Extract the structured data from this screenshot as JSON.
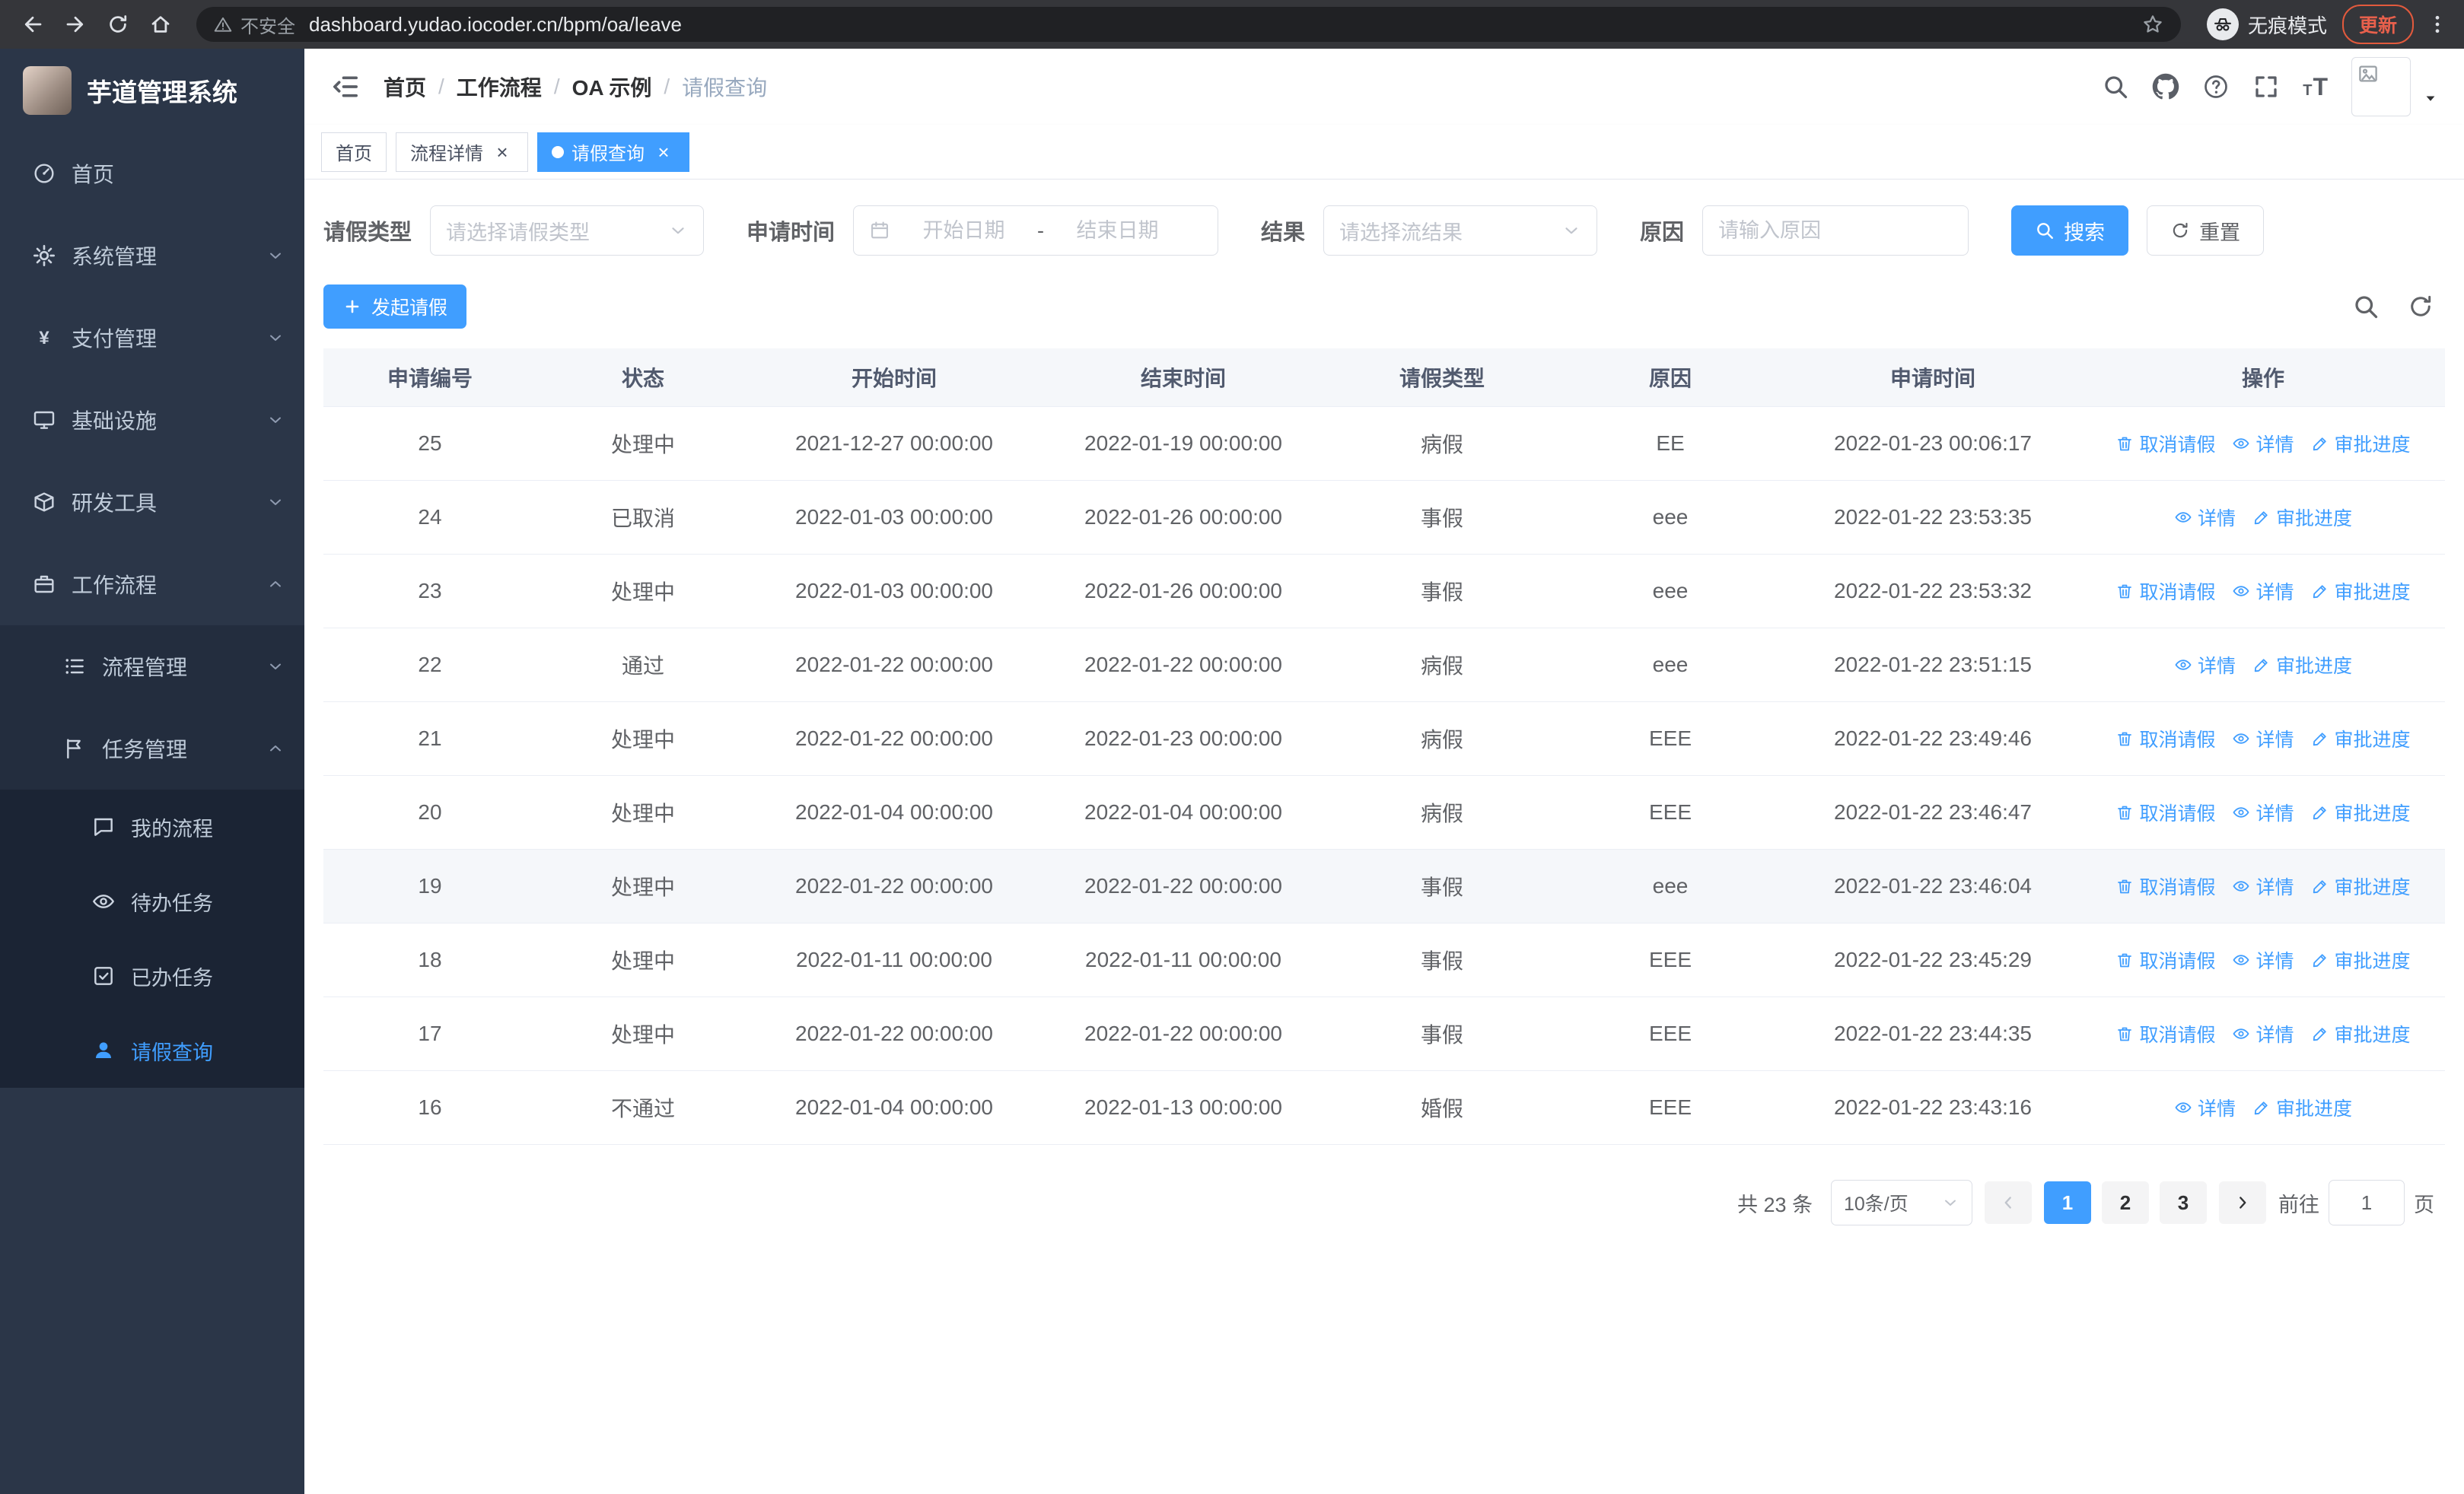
{
  "colors": {
    "accent": "#409eff",
    "sidebar_bg": "#2b3648",
    "sidebar_submenu_bg": "#232d3e",
    "sidebar_subsubmenu_bg": "#1b2434",
    "chrome_bg": "#35363a",
    "update_accent": "#e25a3d",
    "table_header_bg": "#f5f7fa"
  },
  "browser": {
    "security_label": "不安全",
    "url": "dashboard.yudao.iocoder.cn/bpm/oa/leave",
    "incognito_label": "无痕模式",
    "update_label": "更新"
  },
  "sidebar": {
    "logo_title": "芋道管理系统",
    "items": [
      {
        "name": "home",
        "label": "首页",
        "icon": "dashboard",
        "depth": 1
      },
      {
        "name": "system-management",
        "label": "系统管理",
        "icon": "gear",
        "depth": 1,
        "arrow": "down"
      },
      {
        "name": "payment-management",
        "label": "支付管理",
        "icon": "yen",
        "depth": 1,
        "arrow": "down"
      },
      {
        "name": "infrastructure",
        "label": "基础设施",
        "icon": "monitor",
        "depth": 1,
        "arrow": "down"
      },
      {
        "name": "dev-tools",
        "label": "研发工具",
        "icon": "box",
        "depth": 1,
        "arrow": "down"
      },
      {
        "name": "workflow",
        "label": "工作流程",
        "icon": "briefcase",
        "depth": 1,
        "arrow": "up"
      },
      {
        "name": "process-management",
        "label": "流程管理",
        "icon": "list",
        "depth": 2,
        "arrow": "down"
      },
      {
        "name": "task-management",
        "label": "任务管理",
        "icon": "flag",
        "depth": 2,
        "arrow": "up"
      },
      {
        "name": "my-process",
        "label": "我的流程",
        "icon": "chat",
        "depth": 3
      },
      {
        "name": "todo-task",
        "label": "待办任务",
        "icon": "eye",
        "depth": 3
      },
      {
        "name": "done-task",
        "label": "已办任务",
        "icon": "check-square",
        "depth": 3
      },
      {
        "name": "leave-query",
        "label": "请假查询",
        "icon": "person",
        "depth": 3,
        "active": true
      }
    ]
  },
  "header": {
    "breadcrumb": [
      "首页",
      "工作流程",
      "OA 示例",
      "请假查询"
    ]
  },
  "tabs": [
    {
      "label": "首页",
      "active": false,
      "closable": false
    },
    {
      "label": "流程详情",
      "active": false,
      "closable": true
    },
    {
      "label": "请假查询",
      "active": true,
      "closable": true
    }
  ],
  "filters": {
    "leave_type_label": "请假类型",
    "leave_type_placeholder": "请选择请假类型",
    "apply_time_label": "申请时间",
    "date_start_placeholder": "开始日期",
    "date_separator": "-",
    "date_end_placeholder": "结束日期",
    "result_label": "结果",
    "result_placeholder": "请选择流结果",
    "reason_label": "原因",
    "reason_placeholder": "请输入原因",
    "search_label": "搜索",
    "reset_label": "重置"
  },
  "toolbar": {
    "create_label": "发起请假"
  },
  "table": {
    "columns": [
      "申请编号",
      "状态",
      "开始时间",
      "结束时间",
      "请假类型",
      "原因",
      "申请时间",
      "操作"
    ],
    "action_labels": {
      "cancel": "取消请假",
      "detail": "详情",
      "progress": "审批进度"
    },
    "rows": [
      {
        "id": "25",
        "status": "处理中",
        "start": "2021-12-27 00:00:00",
        "end": "2022-01-19 00:00:00",
        "type": "病假",
        "reason": "EE",
        "apply": "2022-01-23 00:06:17",
        "actions": [
          "cancel",
          "detail",
          "progress"
        ]
      },
      {
        "id": "24",
        "status": "已取消",
        "start": "2022-01-03 00:00:00",
        "end": "2022-01-26 00:00:00",
        "type": "事假",
        "reason": "eee",
        "apply": "2022-01-22 23:53:35",
        "actions": [
          "detail",
          "progress"
        ]
      },
      {
        "id": "23",
        "status": "处理中",
        "start": "2022-01-03 00:00:00",
        "end": "2022-01-26 00:00:00",
        "type": "事假",
        "reason": "eee",
        "apply": "2022-01-22 23:53:32",
        "actions": [
          "cancel",
          "detail",
          "progress"
        ]
      },
      {
        "id": "22",
        "status": "通过",
        "start": "2022-01-22 00:00:00",
        "end": "2022-01-22 00:00:00",
        "type": "病假",
        "reason": "eee",
        "apply": "2022-01-22 23:51:15",
        "actions": [
          "detail",
          "progress"
        ]
      },
      {
        "id": "21",
        "status": "处理中",
        "start": "2022-01-22 00:00:00",
        "end": "2022-01-23 00:00:00",
        "type": "病假",
        "reason": "EEE",
        "apply": "2022-01-22 23:49:46",
        "actions": [
          "cancel",
          "detail",
          "progress"
        ]
      },
      {
        "id": "20",
        "status": "处理中",
        "start": "2022-01-04 00:00:00",
        "end": "2022-01-04 00:00:00",
        "type": "病假",
        "reason": "EEE",
        "apply": "2022-01-22 23:46:47",
        "actions": [
          "cancel",
          "detail",
          "progress"
        ]
      },
      {
        "id": "19",
        "status": "处理中",
        "start": "2022-01-22 00:00:00",
        "end": "2022-01-22 00:00:00",
        "type": "事假",
        "reason": "eee",
        "apply": "2022-01-22 23:46:04",
        "actions": [
          "cancel",
          "detail",
          "progress"
        ],
        "highlighted": true
      },
      {
        "id": "18",
        "status": "处理中",
        "start": "2022-01-11 00:00:00",
        "end": "2022-01-11 00:00:00",
        "type": "事假",
        "reason": "EEE",
        "apply": "2022-01-22 23:45:29",
        "actions": [
          "cancel",
          "detail",
          "progress"
        ]
      },
      {
        "id": "17",
        "status": "处理中",
        "start": "2022-01-22 00:00:00",
        "end": "2022-01-22 00:00:00",
        "type": "事假",
        "reason": "EEE",
        "apply": "2022-01-22 23:44:35",
        "actions": [
          "cancel",
          "detail",
          "progress"
        ]
      },
      {
        "id": "16",
        "status": "不通过",
        "start": "2022-01-04 00:00:00",
        "end": "2022-01-13 00:00:00",
        "type": "婚假",
        "reason": "EEE",
        "apply": "2022-01-22 23:43:16",
        "actions": [
          "detail",
          "progress"
        ]
      }
    ]
  },
  "pagination": {
    "total_label": "共 23 条",
    "page_size": "10条/页",
    "pages": [
      "1",
      "2",
      "3"
    ],
    "active_page": "1",
    "goto_label": "前往",
    "goto_value": "1",
    "goto_suffix": "页"
  }
}
